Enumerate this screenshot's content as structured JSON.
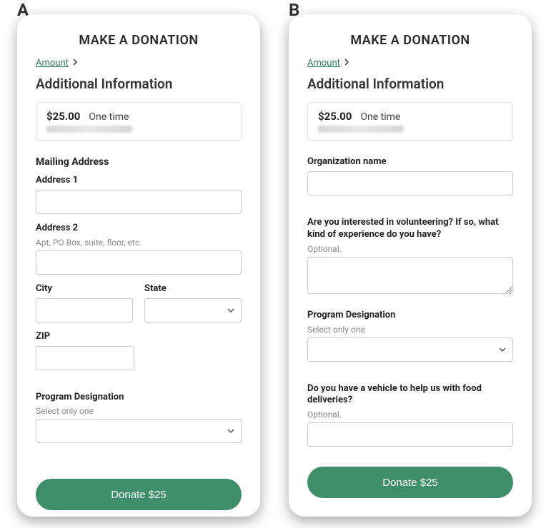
{
  "labels": {
    "A": "A",
    "B": "B"
  },
  "common": {
    "title": "MAKE A DONATION",
    "breadcrumb": "Amount",
    "section_heading": "Additional Information",
    "summary_amount": "$25.00",
    "summary_frequency": "One time",
    "donate_label": "Donate $25"
  },
  "panelA": {
    "mailing_heading": "Mailing Address",
    "address1_label": "Address 1",
    "address2_label": "Address 2",
    "address2_help": "Apt, PO Box, suite, floor, etc.",
    "city_label": "City",
    "state_label": "State",
    "zip_label": "ZIP",
    "program_label": "Program Designation",
    "program_help": "Select only one"
  },
  "panelB": {
    "org_label": "Organization name",
    "volunteer_label": "Are you interested in volunteering? If so, what kind of experience do you have?",
    "optional": "Optional.",
    "program_label": "Program Designation",
    "program_help": "Select only one",
    "vehicle_label": "Do you have a vehicle to help us with food deliveries?"
  }
}
